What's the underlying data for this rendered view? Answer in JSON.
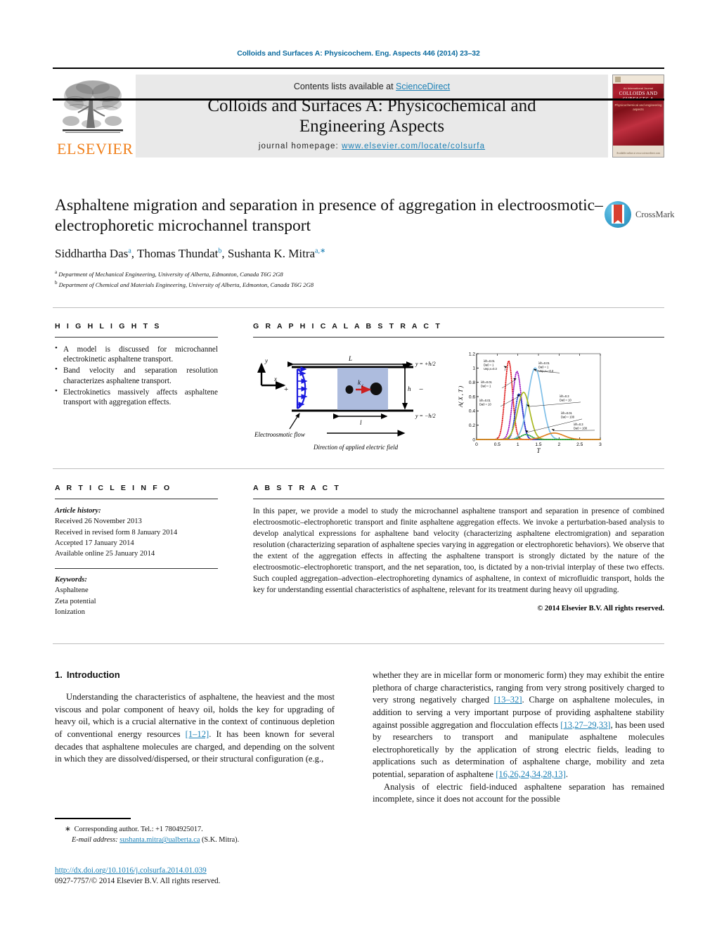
{
  "running_head": "Colloids and Surfaces A: Physicochem. Eng. Aspects 446 (2014) 23–32",
  "masthead": {
    "contents_prefix": "Contents lists available at ",
    "sciencedirect": "ScienceDirect",
    "journal_title_line1": "Colloids and Surfaces A: Physicochemical and",
    "journal_title_line2": "Engineering Aspects",
    "homepage_label": "journal homepage:",
    "homepage_url": "www.elsevier.com/locate/colsurfa",
    "publisher": "ELSEVIER",
    "cover": {
      "kicker": "An International Journal",
      "title": "COLLOIDS AND SURFACES A",
      "subtitle": "Physicochemical and engineering aspects",
      "footer": "Available online at www.sciencedirect.com"
    },
    "accent_blue": "#1a7fb5",
    "elsevier_orange": "#f07f1a"
  },
  "article": {
    "title": "Asphaltene migration and separation in presence of aggregation in electroosmotic–electrophoretic microchannel transport",
    "authors_html": "Siddhartha Das<sup>a</sup>, Thomas Thundat<sup>b</sup>, Sushanta K. Mitra<sup>a,∗</sup>",
    "affiliations": [
      {
        "marker": "a",
        "text": "Department of Mechanical Engineering, University of Alberta, Edmonton, Canada T6G 2G8"
      },
      {
        "marker": "b",
        "text": "Department of Chemical and Materials Engineering, University of Alberta, Edmonton, Canada T6G 2G8"
      }
    ],
    "crossmark_label": "CrossMark"
  },
  "highlights": {
    "heading": "H I G H L I G H T S",
    "items": [
      "A model is discussed for microchannel electrokinetic asphaltene transport.",
      "Band velocity and separation resolution characterizes asphaltene transport.",
      "Electrokinetics massively affects asphaltene transport with aggregation effects."
    ]
  },
  "graphical_abstract": {
    "heading": "G R A P H I C A L   A B S T R A C T",
    "diagram": {
      "axis_y": "y",
      "axis_x": "x",
      "length_label": "L",
      "height_label": "h",
      "band_label": "l",
      "rate_label": "k",
      "rate_sub": "i",
      "wall_top": "y = +h/2",
      "wall_bottom": "y = −h/2",
      "plus_sign": "+",
      "minus_sign": "−",
      "flow_caption": "Electroosmotic flow",
      "field_caption": "Direction of applied electric field"
    }
  },
  "chart_data": {
    "type": "line",
    "title": "",
    "xlabel": "T",
    "ylabel": "A( X , T )",
    "xlim": [
      0,
      3
    ],
    "ylim": [
      0,
      1.2
    ],
    "xticks": [
      0,
      0.5,
      1,
      1.5,
      2,
      2.5,
      3
    ],
    "xticklabels": [
      "0",
      "0.5",
      "1",
      "1.5",
      "2",
      "2.5",
      "3"
    ],
    "yticks": [
      0,
      0.2,
      0.4,
      0.6,
      0.8,
      1,
      1.2
    ],
    "yticklabels": [
      "0",
      "0.2",
      "0.4",
      "0.6",
      "0.8",
      "1",
      "1.2"
    ],
    "grid": false,
    "legend_position": "inline-annotations",
    "series": [
      {
        "name": "λ/h=0.01, Da_0 = 1, U_ep,x=0.3",
        "color": "#e02020",
        "style": "dotted",
        "peak_x": 0.78,
        "peak_y": 1.1,
        "width": 0.13,
        "annotation": "λ/h=0.01, Da0 = 1, Uep,x=0.3"
      },
      {
        "name": "λ/h=0.01, Da_0 = 1",
        "color": "#a020c0",
        "style": "dotted",
        "peak_x": 0.98,
        "peak_y": 0.95,
        "width": 0.15,
        "annotation": "λ/h=0.01, Da0 = 1"
      },
      {
        "name": "λ/h=0.01, Da_0 = 10",
        "color": "#2040d0",
        "style": "dotted",
        "peak_x": 1.03,
        "peak_y": 0.64,
        "width": 0.13,
        "annotation": "λ/h=0.01, Da0 = 10"
      },
      {
        "name": "λ/h=0.01, Da_0 = 1, Uep,x=−0.3",
        "color": "#7fbfe8",
        "style": "solid",
        "peak_x": 1.42,
        "peak_y": 1.0,
        "width": 0.24,
        "annotation": "λ/h=0.01, Da0 = 1, Uep,x=−0.3"
      },
      {
        "name": "λ/h=0.3, Da_0 = 10",
        "color": "#a8b820",
        "style": "solid",
        "peak_x": 1.14,
        "peak_y": 0.66,
        "width": 0.21,
        "annotation": "λ/h=0.3, Da0 = 10"
      },
      {
        "name": "λ/h=0.01, Da_0 = 100",
        "color": "#20a040",
        "style": "dotted",
        "peak_x": 1.2,
        "peak_y": 0.07,
        "width": 0.18,
        "annotation": "λ/h=0.01, Da0 = 100"
      },
      {
        "name": "λ/h=0.3, Da_0 = 100",
        "color": "#e08020",
        "style": "solid",
        "peak_x": 1.88,
        "peak_y": 0.09,
        "width": 0.33,
        "annotation": "λ/h=0.3, Da0 = 100"
      }
    ]
  },
  "article_info": {
    "heading": "A R T I C L E   I N F O",
    "history_label": "Article history:",
    "history": [
      "Received 26 November 2013",
      "Received in revised form 8 January 2014",
      "Accepted 17 January 2014",
      "Available online 25 January 2014"
    ],
    "keywords_label": "Keywords:",
    "keywords": [
      "Asphaltene",
      "Zeta potential",
      "Ionization"
    ]
  },
  "abstract": {
    "heading": "A B S T R A C T",
    "text": "In this paper, we provide a model to study the microchannel asphaltene transport and separation in presence of combined electroosmotic–electrophoretic transport and finite asphaltene aggregation effects. We invoke a perturbation-based analysis to develop analytical expressions for asphaltene band velocity (characterizing asphaltene electromigration) and separation resolution (characterizing separation of asphaltene species varying in aggregation or electrophoretic behaviors). We observe that the extent of the aggregation effects in affecting the asphaltene transport is strongly dictated by the nature of the electroosmotic–electrophoretic transport, and the net separation, too, is dictated by a non-trivial interplay of these two effects. Such coupled aggregation–advection–electrophoreting dynamics of asphaltene, in context of microfluidic transport, holds the key for understanding essential characteristics of asphaltene, relevant for its treatment during heavy oil upgrading.",
    "copyright": "© 2014 Elsevier B.V. All rights reserved."
  },
  "body": {
    "section_number": "1.",
    "section_title": "Introduction",
    "left_paragraph_parts": [
      "Understanding the characteristics of asphaltene, the heaviest and the most viscous and polar component of heavy oil, holds the key for upgrading of heavy oil, which is a crucial alternative in the context of continuous depletion of conventional energy resources ",
      "[1–12]",
      ". It has been known for several decades that asphaltene molecules are charged, and depending on the solvent in which they are dissolved/dispersed, or their structural configuration (e.g.,"
    ],
    "right_paragraph1_parts": [
      "whether they are in micellar form or monomeric form) they may exhibit the entire plethora of charge characteristics, ranging from very strong positively charged to very strong negatively charged ",
      "[13–32]",
      ". Charge on asphaltene molecules, in addition to serving a very important purpose of providing asphaltene stability against possible aggregation and flocculation effects ",
      "[13,27–29,33]",
      ", has been used by researchers to transport and manipulate asphaltene molecules electrophoretically by the application of strong electric fields, leading to applications such as determination of asphaltene charge, mobility and zeta potential, separation of asphaltene ",
      "[16,26,24,34,28,13]",
      "."
    ],
    "right_paragraph2": "Analysis of electric field-induced asphaltene separation has remained incomplete, since it does not account for the possible"
  },
  "footer": {
    "corresponding_star": "∗",
    "corresponding_text": "Corresponding author. Tel.: +1 7804925017.",
    "email_label": "E-mail address:",
    "email": "sushanta.mitra@ualberta.ca",
    "email_suffix": "(S.K. Mitra).",
    "doi": "http://dx.doi.org/10.1016/j.colsurfa.2014.01.039",
    "issn_line": "0927-7757/© 2014 Elsevier B.V. All rights reserved."
  }
}
